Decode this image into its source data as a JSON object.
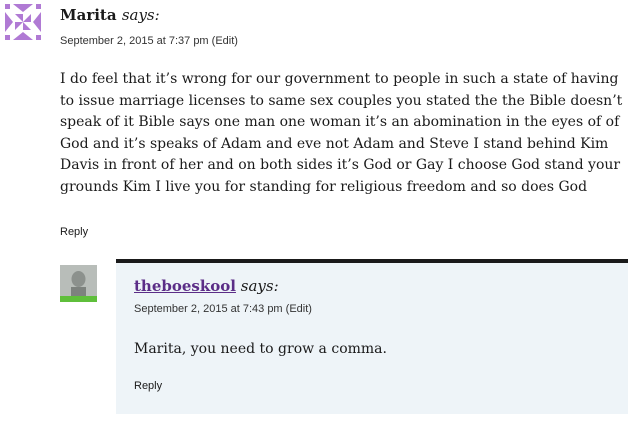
{
  "comments": [
    {
      "author": "Marita",
      "says": "says:",
      "date": "September 2, 2015 at 7:37 pm",
      "edit_label": "(Edit)",
      "body": "I do feel that it’s wrong for our government to people in such a state of having to issue marriage licenses to same sex couples you stated the the Bible doesn’t speak of it Bible says one man one woman it’s an abomination in the eyes of of God and it’s speaks of Adam and eve not Adam and Steve I stand behind Kim Davis in front of her and on both sides it’s God or Gay I choose God stand your grounds Kim I live you for standing for religious freedom and so does God",
      "reply_label": "Reply",
      "avatar_icon": "identicon-avatar",
      "avatar_color": "#b07ad4"
    },
    {
      "author": "theboeskool",
      "says": "says:",
      "date": "September 2, 2015 at 7:43 pm",
      "edit_label": "(Edit)",
      "body": "Marita, you need to grow a comma.",
      "reply_label": "Reply",
      "avatar_icon": "user-photo-avatar",
      "author_color": "#5b2d87",
      "box_background": "#eef4f8"
    }
  ]
}
